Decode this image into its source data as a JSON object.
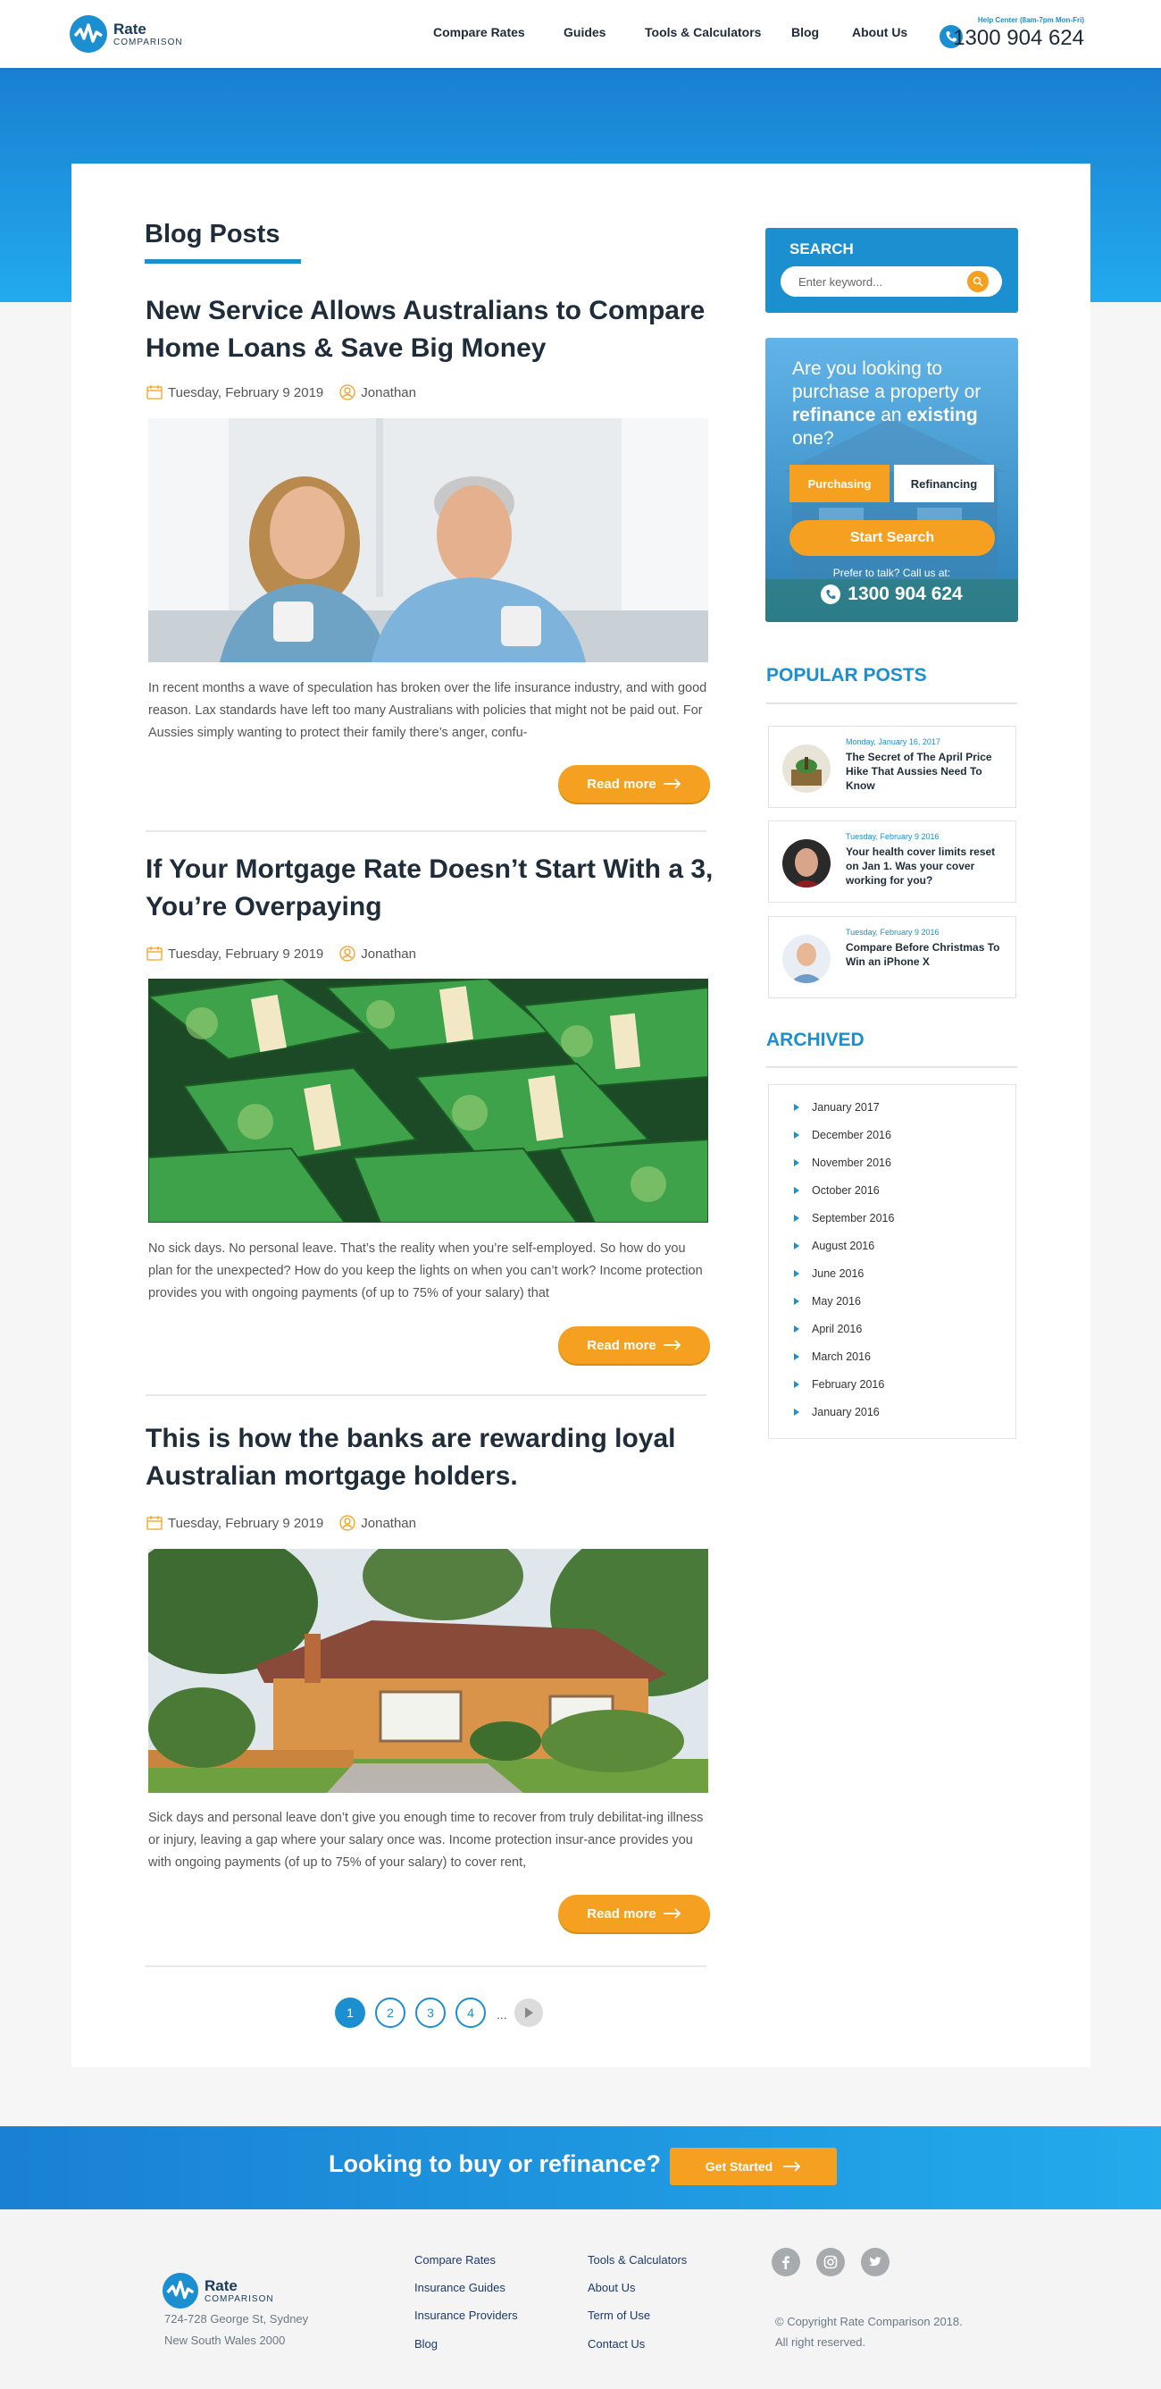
{
  "header": {
    "logo_word": "Rate",
    "logo_sub": "COMPARISON",
    "nav": [
      "Compare Rates",
      "Guides",
      "Tools & Calculators",
      "Blog",
      "About Us"
    ],
    "help_center": "Help Center (8am-7pm Mon-Fri)",
    "phone": "1300 904 624"
  },
  "blog": {
    "heading": "Blog Posts",
    "read_more": "Read more",
    "posts": [
      {
        "title": "New Service Allows Australians to Compare Home Loans & Save Big Money",
        "date": "Tuesday, February 9 2019",
        "author": "Jonathan",
        "excerpt": "In recent months a wave of speculation has broken over the life insurance industry, and with good reason. Lax standards have left too many Australians with policies that might not be paid out. For Aussies simply wanting to protect their family there’s anger, confu-"
      },
      {
        "title": "If Your Mortgage Rate Doesn’t Start With a 3, You’re Overpaying",
        "date": "Tuesday, February 9 2019",
        "author": "Jonathan",
        "excerpt": "No sick days. No personal leave. That’s the reality when you’re self-employed. So how do you plan for the unexpected? How do you keep the lights on when you can’t work? Income protection provides you with ongoing payments (of up to 75% of your salary) that"
      },
      {
        "title": "This is how the banks are rewarding loyal Australian mortgage holders.",
        "date": "Tuesday, February 9 2019",
        "author": "Jonathan",
        "excerpt": "Sick days and personal leave don’t give you enough time to recover from truly debilitat-ing illness or injury, leaving a gap where your salary once was. Income protection insur-ance provides you with ongoing payments (of up to 75% of your salary) to cover rent,"
      }
    ],
    "pagination": [
      "1",
      "2",
      "3",
      "4",
      "..."
    ]
  },
  "sidebar": {
    "search_title": "SEARCH",
    "search_placeholder": "Enter keyword...",
    "promo": {
      "q1": "Are you looking to purchase a property or ",
      "q_bold1": "refinance",
      "q2": " an ",
      "q_bold2": "existing",
      "q3": " one?",
      "tab_purchasing": "Purchasing",
      "tab_refinancing": "Refinancing",
      "start": "Start Search",
      "prefer": "Prefer to talk? Call us at:",
      "phone": "1300 904 624"
    },
    "popular_title": "POPULAR POSTS",
    "popular": [
      {
        "date": "Monday, January 16, 2017",
        "title": "The Secret of The April Price Hike That Aussies Need To Know"
      },
      {
        "date": "Tuesday, February 9 2016",
        "title": "Your health cover limits reset on Jan 1. Was your cover working for you?"
      },
      {
        "date": "Tuesday, February 9 2016",
        "title": "Compare Before Christmas To Win an iPhone X"
      }
    ],
    "archived_title": "ARCHIVED",
    "archived": [
      "January 2017",
      "December 2016",
      "November 2016",
      "October 2016",
      "September 2016",
      "August 2016",
      "June 2016",
      "May 2016",
      "April 2016",
      "March 2016",
      "February 2016",
      "January 2016"
    ]
  },
  "cta": {
    "text": "Looking to buy or refinance?",
    "button": "Get Started"
  },
  "footer": {
    "address1": "724-728 George St, Sydney",
    "address2": "New South Wales 2000",
    "col1": [
      "Compare Rates",
      "Insurance Guides",
      "Insurance Providers",
      "Blog"
    ],
    "col2": [
      "Tools & Calculators",
      "About Us",
      "Term of Use",
      "Contact Us"
    ],
    "copyright": "© Copyright Rate Comparison 2018.",
    "rights": "All right reserved."
  },
  "colors": {
    "primary": "#1b8fd0",
    "accent": "#f5a020",
    "dark": "#1f2d3a"
  }
}
